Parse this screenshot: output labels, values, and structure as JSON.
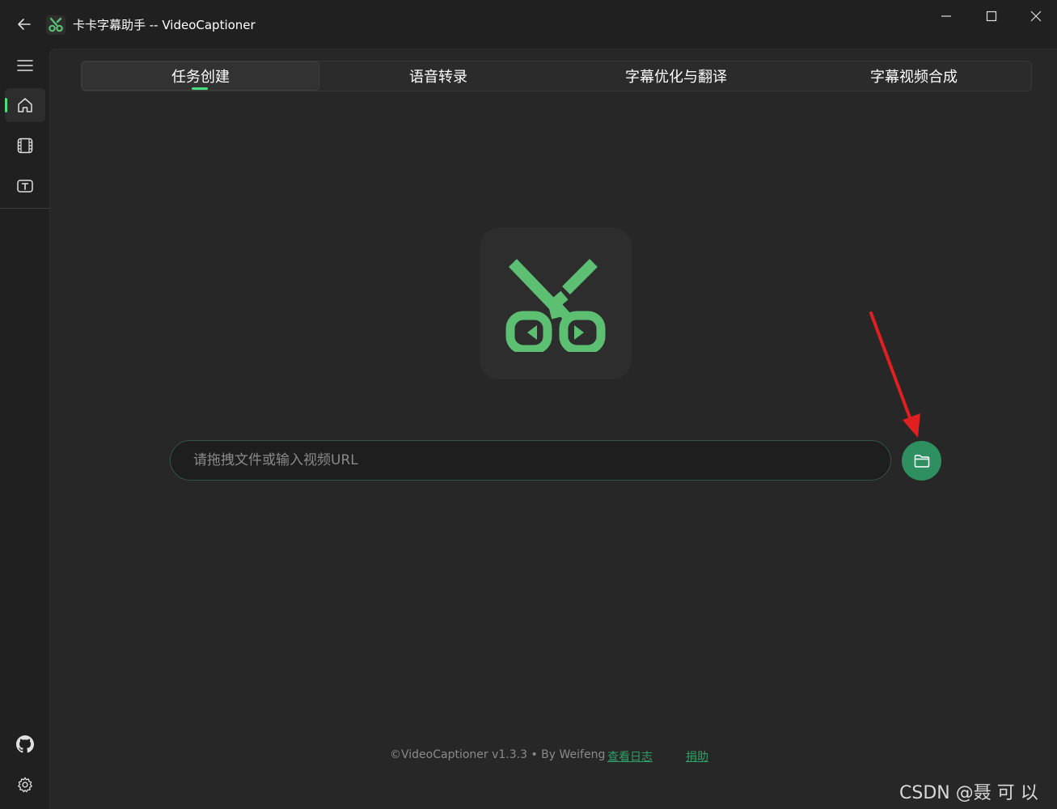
{
  "window": {
    "title": "卡卡字幕助手 -- VideoCaptioner"
  },
  "tabs": [
    {
      "label": "任务创建",
      "active": true
    },
    {
      "label": "语音转录",
      "active": false
    },
    {
      "label": "字幕优化与翻译",
      "active": false
    },
    {
      "label": "字幕视频合成",
      "active": false
    }
  ],
  "nav": {
    "items": [
      {
        "icon": "menu-icon"
      },
      {
        "icon": "home-icon",
        "active": true
      },
      {
        "icon": "film-icon"
      },
      {
        "icon": "text-box-icon"
      }
    ],
    "bottom": [
      {
        "icon": "github-icon"
      },
      {
        "icon": "gear-icon"
      }
    ]
  },
  "input": {
    "placeholder": "请拖拽文件或输入视频URL",
    "value": ""
  },
  "footer": {
    "copyright": "©VideoCaptioner v1.3.3 • By Weifeng",
    "log_link": "查看日志",
    "donate_link": "捐助"
  },
  "watermark": "CSDN @聂 可 以",
  "colors": {
    "accent": "#4ade80",
    "button": "#2e8f60",
    "logo": "#5cbf72",
    "annotation": "#e02020"
  }
}
